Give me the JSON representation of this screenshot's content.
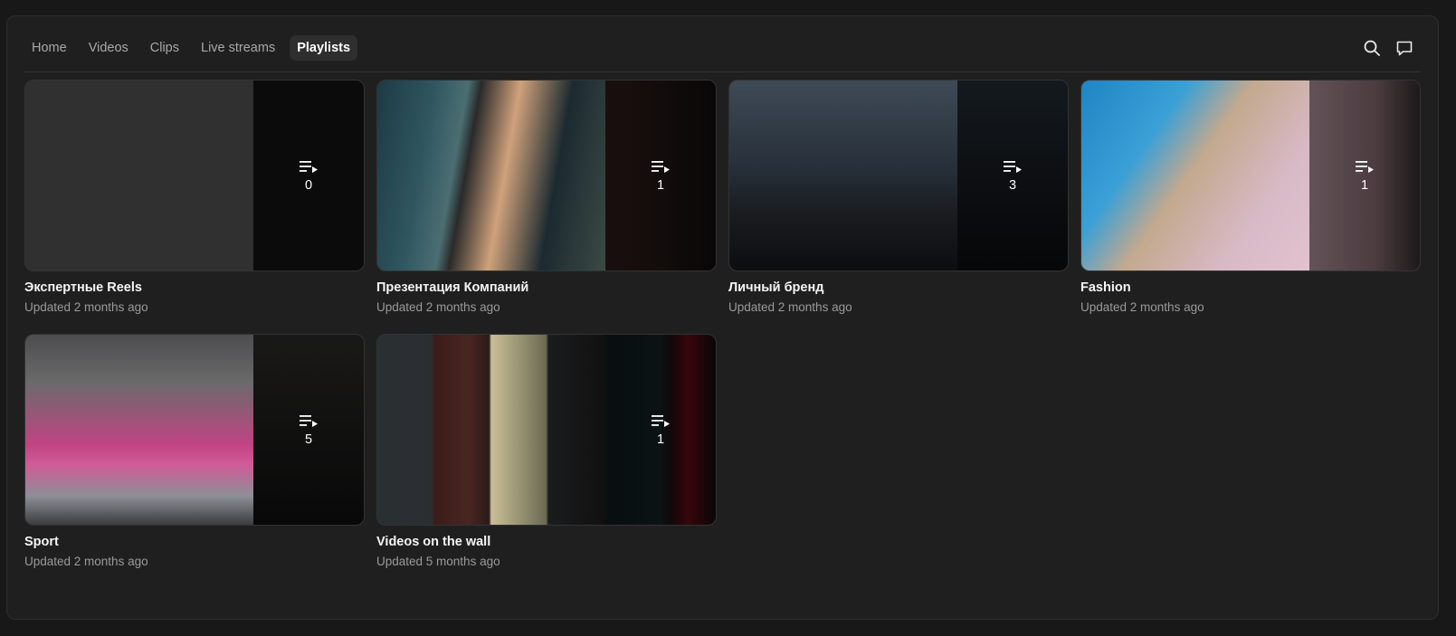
{
  "nav": {
    "tabs": [
      {
        "label": "Home",
        "active": false
      },
      {
        "label": "Videos",
        "active": false
      },
      {
        "label": "Clips",
        "active": false
      },
      {
        "label": "Live streams",
        "active": false
      },
      {
        "label": "Playlists",
        "active": true
      }
    ],
    "icons": [
      "search-icon",
      "chat-bubble-icon"
    ]
  },
  "playlists": [
    {
      "title": "Экспертные Reels",
      "updated": "Updated 2 months ago",
      "count": "0"
    },
    {
      "title": "Презентация Компаний",
      "updated": "Updated 2 months ago",
      "count": "1"
    },
    {
      "title": "Личный бренд",
      "updated": "Updated 2 months ago",
      "count": "3"
    },
    {
      "title": "Fashion",
      "updated": "Updated 2 months ago",
      "count": "1"
    },
    {
      "title": "Sport",
      "updated": "Updated 2 months ago",
      "count": "5"
    },
    {
      "title": "Videos on the wall",
      "updated": "Updated 5 months ago",
      "count": "1"
    }
  ],
  "colors": {
    "background": "#181818",
    "panel": "#1f1f1f",
    "active_tab": "#2e2e2e",
    "muted_text": "#9a9a9a"
  }
}
